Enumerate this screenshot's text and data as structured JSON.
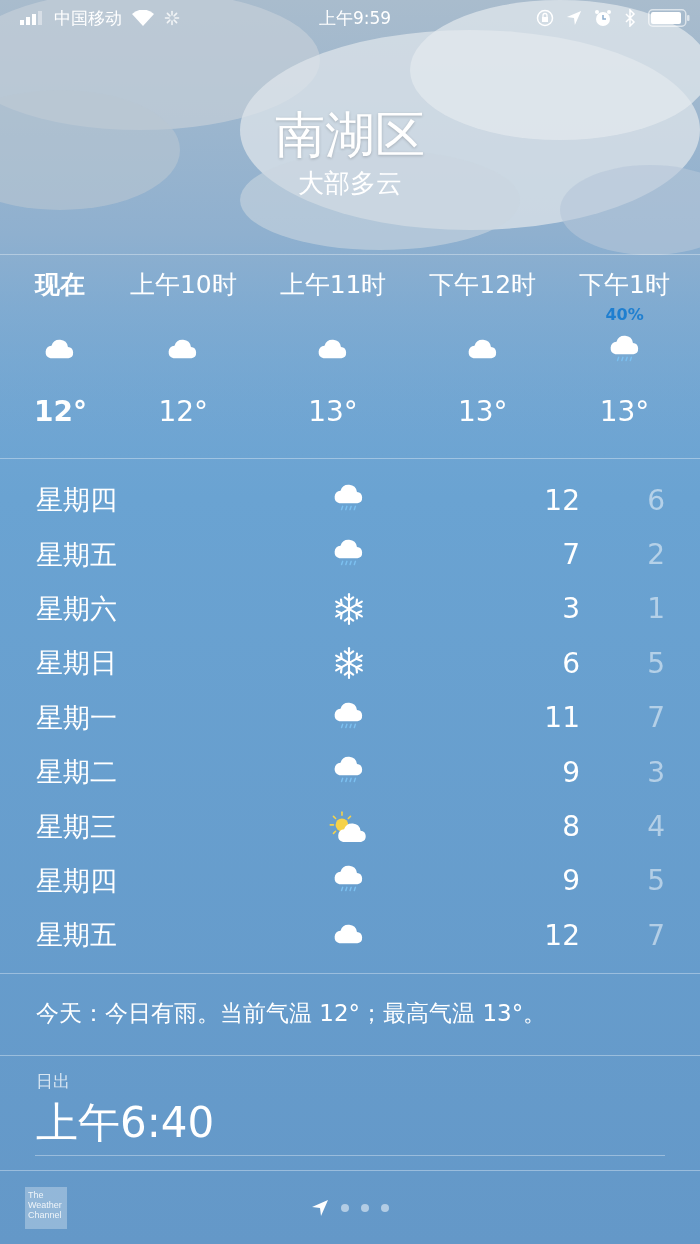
{
  "status_bar": {
    "carrier": "中国移动",
    "time": "上午9:59"
  },
  "header": {
    "city": "南湖区",
    "condition": "大部多云"
  },
  "hourly": [
    {
      "label": "现在",
      "current": true,
      "kind": "cloud",
      "temp": "12°"
    },
    {
      "label": "上午10时",
      "current": false,
      "kind": "cloud",
      "temp": "12°"
    },
    {
      "label": "上午11时",
      "current": false,
      "kind": "cloud",
      "temp": "13°"
    },
    {
      "label": "下午12时",
      "current": false,
      "kind": "cloud",
      "temp": "13°"
    },
    {
      "label": "下午1时",
      "current": false,
      "precipitation": "40%",
      "kind": "rain",
      "temp": "13°"
    }
  ],
  "daily": [
    {
      "day": "星期四",
      "kind": "rain",
      "high": "12",
      "low": "6"
    },
    {
      "day": "星期五",
      "kind": "rain",
      "high": "7",
      "low": "2"
    },
    {
      "day": "星期六",
      "kind": "snow",
      "high": "3",
      "low": "1"
    },
    {
      "day": "星期日",
      "kind": "snow",
      "high": "6",
      "low": "5"
    },
    {
      "day": "星期一",
      "kind": "rain",
      "high": "11",
      "low": "7"
    },
    {
      "day": "星期二",
      "kind": "rain",
      "high": "9",
      "low": "3"
    },
    {
      "day": "星期三",
      "kind": "partly_sunny",
      "high": "8",
      "low": "4"
    },
    {
      "day": "星期四",
      "kind": "rain",
      "high": "9",
      "low": "5"
    },
    {
      "day": "星期五",
      "kind": "cloud",
      "high": "12",
      "low": "7"
    }
  ],
  "summary": "今天：今日有雨。当前气温 12°；最高气温 13°。",
  "details": [
    {
      "label": "日出",
      "value": "上午6:40"
    }
  ],
  "bottom_bar": {
    "logo_text": "The Weather Channel",
    "pages": [
      {
        "kind": "location",
        "selected": true
      },
      {
        "kind": "dot",
        "selected": false
      },
      {
        "kind": "dot",
        "selected": false
      },
      {
        "kind": "dot",
        "selected": false
      }
    ]
  }
}
